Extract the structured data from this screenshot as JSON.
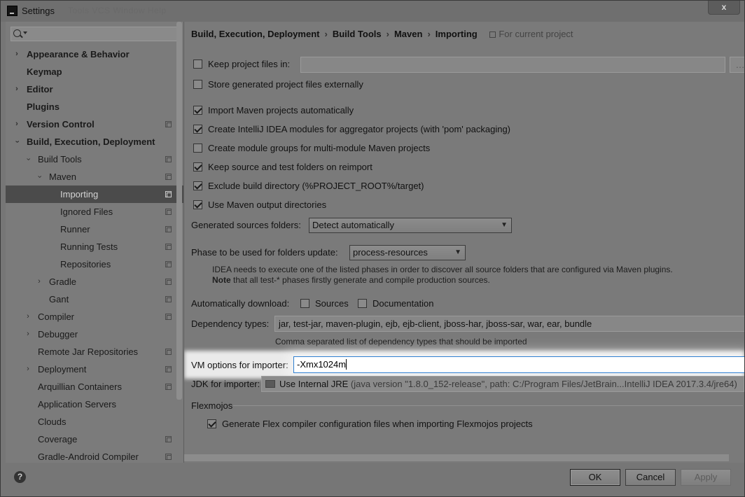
{
  "window": {
    "title": "Settings",
    "ghost_menu": "Tools VCS Window Help",
    "close_label": "x"
  },
  "search": {
    "value": "",
    "placeholder": ""
  },
  "sidebar": {
    "items": [
      {
        "label": "Appearance & Behavior",
        "level": 0,
        "bold": true,
        "chevron": "closed",
        "scope": false
      },
      {
        "label": "Keymap",
        "level": 0,
        "bold": true,
        "chevron": "none",
        "scope": false
      },
      {
        "label": "Editor",
        "level": 0,
        "bold": true,
        "chevron": "closed",
        "scope": false
      },
      {
        "label": "Plugins",
        "level": 0,
        "bold": true,
        "chevron": "none",
        "scope": false
      },
      {
        "label": "Version Control",
        "level": 0,
        "bold": true,
        "chevron": "closed",
        "scope": true
      },
      {
        "label": "Build, Execution, Deployment",
        "level": 0,
        "bold": true,
        "chevron": "open",
        "scope": false
      },
      {
        "label": "Build Tools",
        "level": 1,
        "bold": false,
        "chevron": "open",
        "scope": true
      },
      {
        "label": "Maven",
        "level": 2,
        "bold": false,
        "chevron": "open",
        "scope": true
      },
      {
        "label": "Importing",
        "level": 3,
        "bold": false,
        "chevron": "none",
        "scope": true,
        "selected": true
      },
      {
        "label": "Ignored Files",
        "level": 3,
        "bold": false,
        "chevron": "none",
        "scope": true
      },
      {
        "label": "Runner",
        "level": 3,
        "bold": false,
        "chevron": "none",
        "scope": true
      },
      {
        "label": "Running Tests",
        "level": 3,
        "bold": false,
        "chevron": "none",
        "scope": true
      },
      {
        "label": "Repositories",
        "level": 3,
        "bold": false,
        "chevron": "none",
        "scope": true
      },
      {
        "label": "Gradle",
        "level": 2,
        "bold": false,
        "chevron": "closed",
        "scope": true
      },
      {
        "label": "Gant",
        "level": 2,
        "bold": false,
        "chevron": "none",
        "scope": true
      },
      {
        "label": "Compiler",
        "level": 1,
        "bold": false,
        "chevron": "closed",
        "scope": true
      },
      {
        "label": "Debugger",
        "level": 1,
        "bold": false,
        "chevron": "closed",
        "scope": false
      },
      {
        "label": "Remote Jar Repositories",
        "level": 1,
        "bold": false,
        "chevron": "none",
        "scope": true
      },
      {
        "label": "Deployment",
        "level": 1,
        "bold": false,
        "chevron": "closed",
        "scope": true
      },
      {
        "label": "Arquillian Containers",
        "level": 1,
        "bold": false,
        "chevron": "none",
        "scope": true
      },
      {
        "label": "Application Servers",
        "level": 1,
        "bold": false,
        "chevron": "none",
        "scope": false
      },
      {
        "label": "Clouds",
        "level": 1,
        "bold": false,
        "chevron": "none",
        "scope": false
      },
      {
        "label": "Coverage",
        "level": 1,
        "bold": false,
        "chevron": "none",
        "scope": true
      },
      {
        "label": "Gradle-Android Compiler",
        "level": 1,
        "bold": false,
        "chevron": "none",
        "scope": true
      }
    ]
  },
  "breadcrumb": {
    "items": [
      "Build, Execution, Deployment",
      "Build Tools",
      "Maven",
      "Importing"
    ],
    "separator": "›",
    "note": "For current project"
  },
  "options": {
    "keep_project_files": {
      "label": "Keep project files in:",
      "checked": false,
      "value": ""
    },
    "store_external": {
      "label": "Store generated project files externally",
      "checked": false
    },
    "import_auto": {
      "label": "Import Maven projects automatically",
      "checked": true
    },
    "create_modules": {
      "label": "Create IntelliJ IDEA modules for aggregator projects (with 'pom' packaging)",
      "checked": true
    },
    "module_groups": {
      "label": "Create module groups for multi-module Maven projects",
      "checked": false
    },
    "keep_source": {
      "label": "Keep source and test folders on reimport",
      "checked": true
    },
    "exclude_build": {
      "label": "Exclude build directory (%PROJECT_ROOT%/target)",
      "checked": true
    },
    "output_dirs": {
      "label": "Use Maven output directories",
      "checked": true
    }
  },
  "generated_sources": {
    "label": "Generated sources folders:",
    "value": "Detect automatically"
  },
  "phase": {
    "label": "Phase to be used for folders update:",
    "value": "process-resources",
    "hint_line1": "IDEA needs to execute one of the listed phases in order to discover all source folders that are configured via Maven plugins.",
    "hint_note_bold": "Note",
    "hint_line2": " that all test-* phases firstly generate and compile production sources."
  },
  "auto_download": {
    "label": "Automatically download:",
    "sources": {
      "label": "Sources",
      "checked": false
    },
    "documentation": {
      "label": "Documentation",
      "checked": false
    }
  },
  "dependency_types": {
    "label": "Dependency types:",
    "value": "jar, test-jar, maven-plugin, ejb, ejb-client, jboss-har, jboss-sar, war, ear, bundle",
    "hint": "Comma separated list of dependency types that should be imported"
  },
  "vm_options": {
    "label": "VM options for importer:",
    "value": "-Xmx1024m"
  },
  "jdk": {
    "label": "JDK for importer:",
    "value": "Use Internal JRE",
    "detail": "(java version \"1.8.0_152-release\", path: C:/Program Files/JetBrain...IntelliJ IDEA 2017.3.4/jre64)"
  },
  "flexmojos": {
    "title": "Flexmojos",
    "generate": {
      "label": "Generate Flex compiler configuration files when importing Flexmojos projects",
      "checked": true
    }
  },
  "footer": {
    "help": "?",
    "ok": "OK",
    "cancel": "Cancel",
    "apply": "Apply"
  }
}
